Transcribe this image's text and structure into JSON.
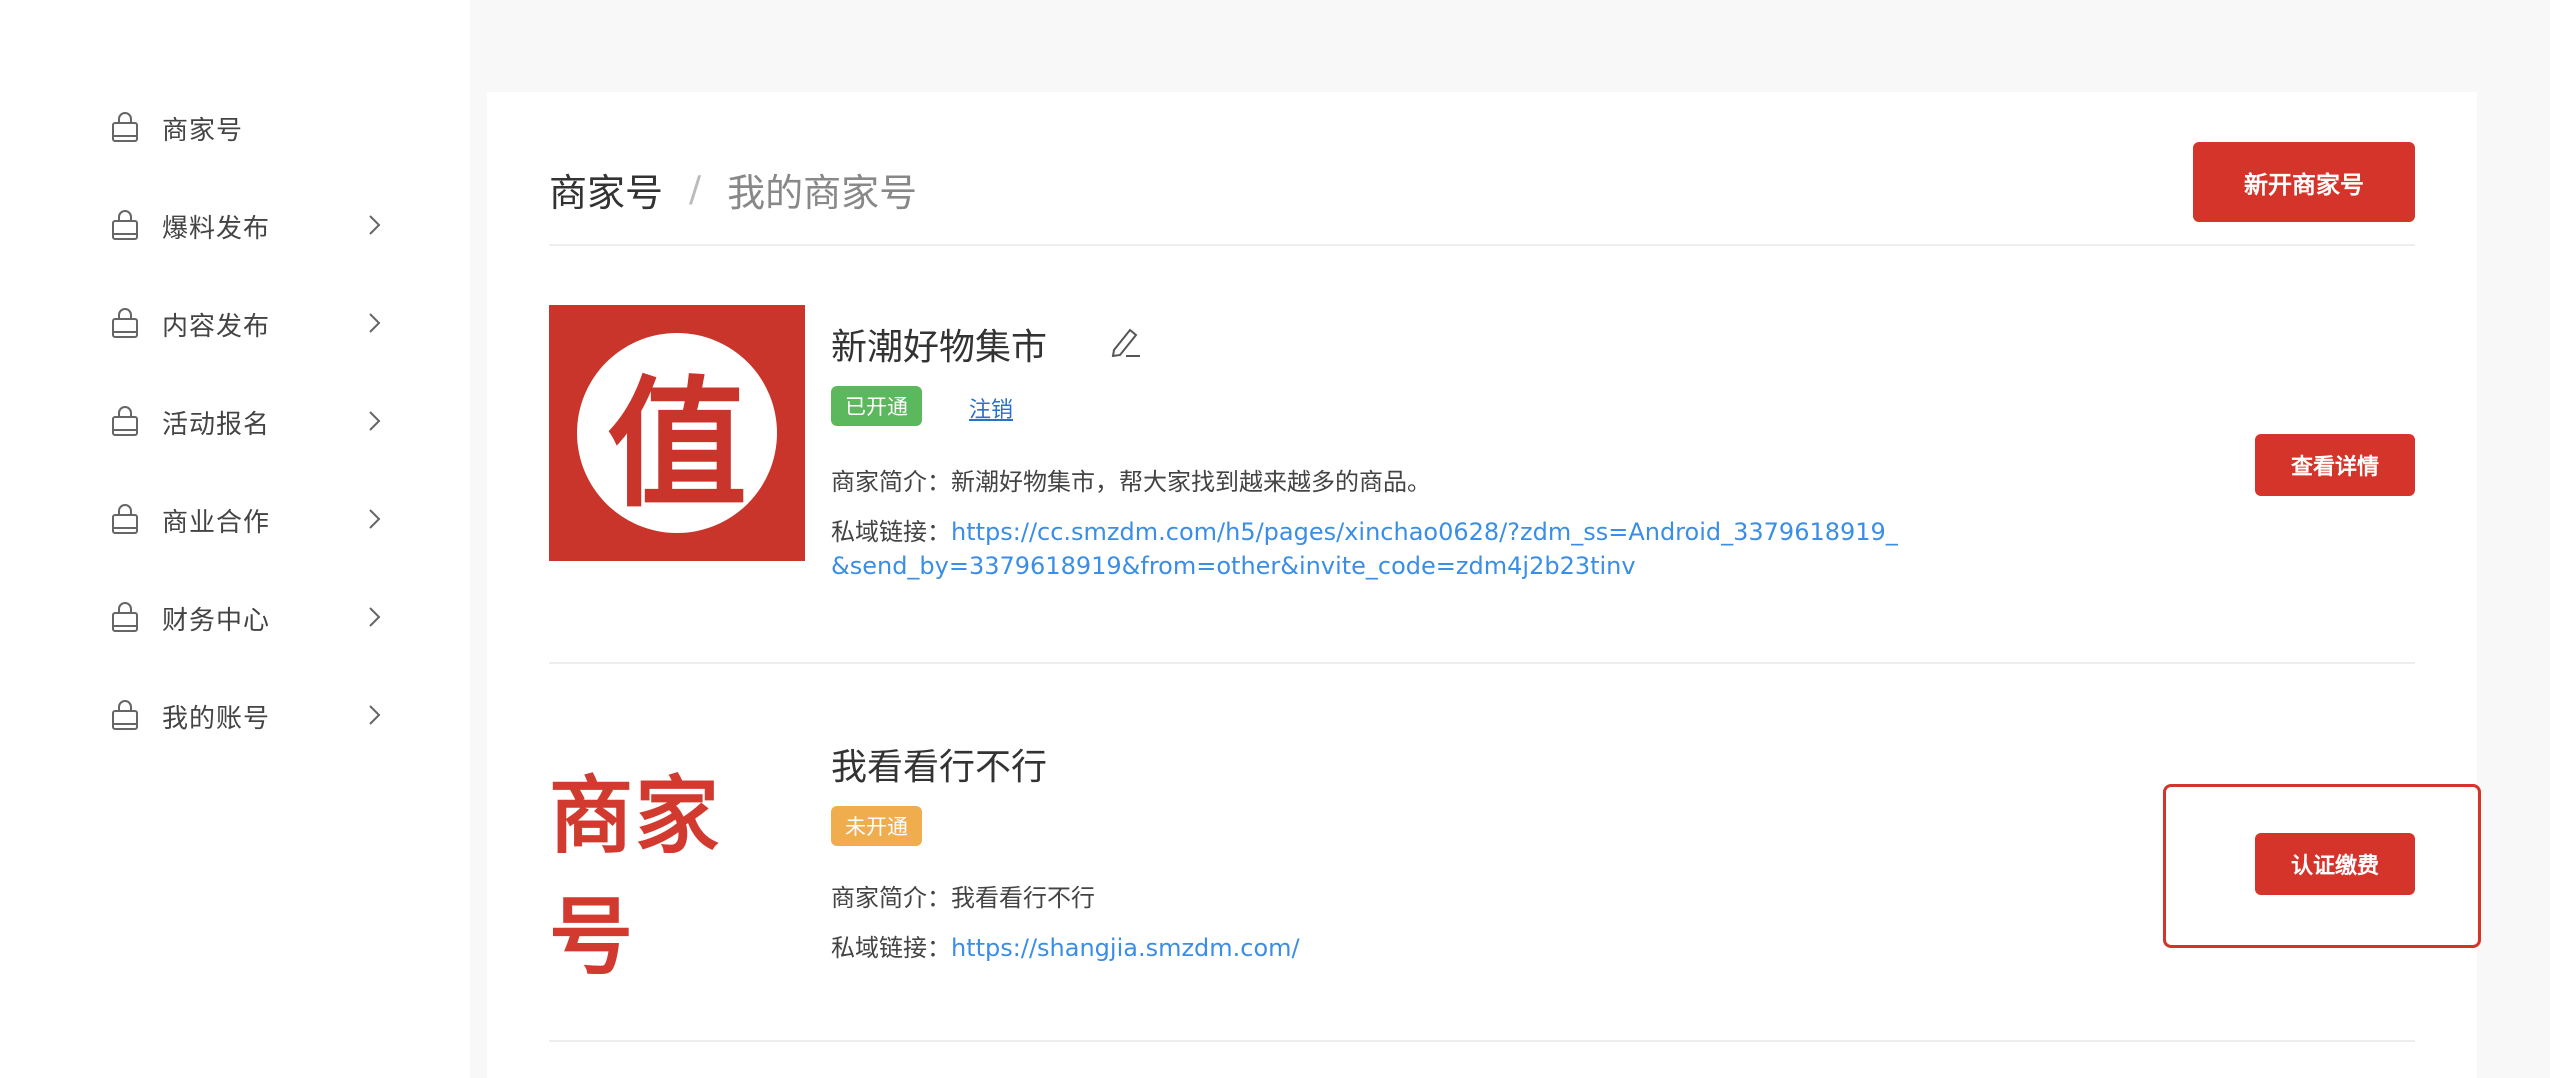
{
  "sidebar": {
    "items": [
      {
        "label": "商家号",
        "has_chevron": false
      },
      {
        "label": "爆料发布",
        "has_chevron": true
      },
      {
        "label": "内容发布",
        "has_chevron": true
      },
      {
        "label": "活动报名",
        "has_chevron": true
      },
      {
        "label": "商业合作",
        "has_chevron": true
      },
      {
        "label": "财务中心",
        "has_chevron": true
      },
      {
        "label": "我的账号",
        "has_chevron": true
      }
    ]
  },
  "breadcrumb": {
    "root": "商家号",
    "separator": "/",
    "current": "我的商家号"
  },
  "header": {
    "new_button_label": "新开商家号"
  },
  "merchants": [
    {
      "logo_char": "值",
      "name": "新潮好物集市",
      "status": "已开通",
      "status_color": "#5cb85c",
      "cancel_label": "注销",
      "intro_label": "商家简介：",
      "intro": "新潮好物集市，帮大家找到越来越多的商品。",
      "link_label": "私域链接：",
      "link_line1": "https://cc.smzdm.com/h5/pages/xinchao0628/?zdm_ss=Android_3379618919_",
      "link_line2": "&send_by=3379618919&from=other&invite_code=zdm4j2b23tinv",
      "action_label": "查看详情"
    },
    {
      "logo_text": "商家号",
      "name": "我看看行不行",
      "status": "未开通",
      "status_color": "#f0ad4e",
      "intro_label": "商家简介：",
      "intro": "我看看行不行",
      "link_label": "私域链接：",
      "link_line1": "https://shangjia.smzdm.com/",
      "action_label": "认证缴费"
    }
  ],
  "colors": {
    "brand_red": "#d4342a",
    "link_blue": "#3a8ee6"
  },
  "icons": {
    "nav": "shopping-bag-icon",
    "chevron": "chevron-right-icon",
    "edit": "pencil-icon"
  }
}
